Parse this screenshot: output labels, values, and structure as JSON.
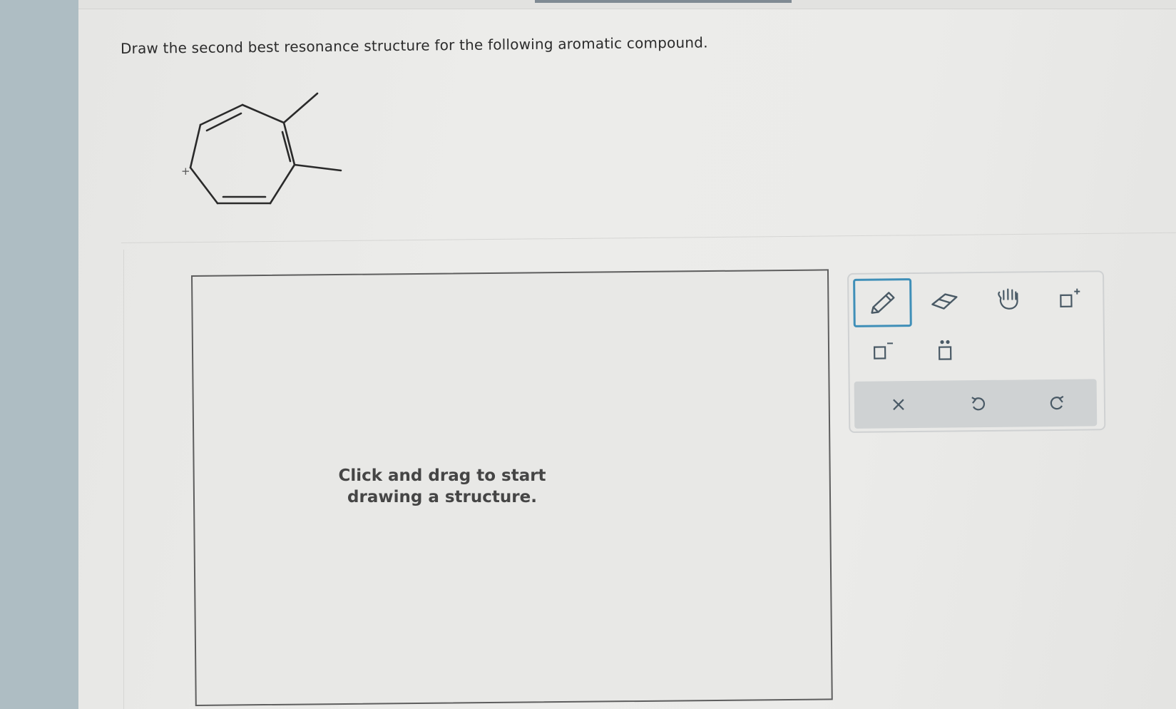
{
  "question": {
    "text": "Draw the second best resonance structure for the following aromatic compound."
  },
  "molecule": {
    "charge_label": "+"
  },
  "canvas": {
    "hint": "Click and drag to start drawing a structure."
  },
  "toolbar": {
    "tools": [
      {
        "name": "pencil-tool",
        "icon": "pencil-icon",
        "selected": true
      },
      {
        "name": "eraser-tool",
        "icon": "eraser-icon",
        "selected": false
      },
      {
        "name": "hand-tool",
        "icon": "hand-icon",
        "selected": false
      },
      {
        "name": "add-positive-charge-tool",
        "icon": "positive-charge-icon",
        "selected": false
      },
      {
        "name": "add-negative-charge-tool",
        "icon": "negative-charge-icon",
        "selected": false
      },
      {
        "name": "add-lone-pair-tool",
        "icon": "lone-pair-icon",
        "selected": false
      }
    ],
    "actions": [
      {
        "name": "clear-button",
        "icon": "close-icon"
      },
      {
        "name": "undo-button",
        "icon": "undo-icon"
      },
      {
        "name": "redo-button",
        "icon": "redo-icon"
      }
    ]
  },
  "colors": {
    "accent": "#3f8fb8",
    "icon": "#4a5a66",
    "action_bar": "#cfd2d3"
  }
}
